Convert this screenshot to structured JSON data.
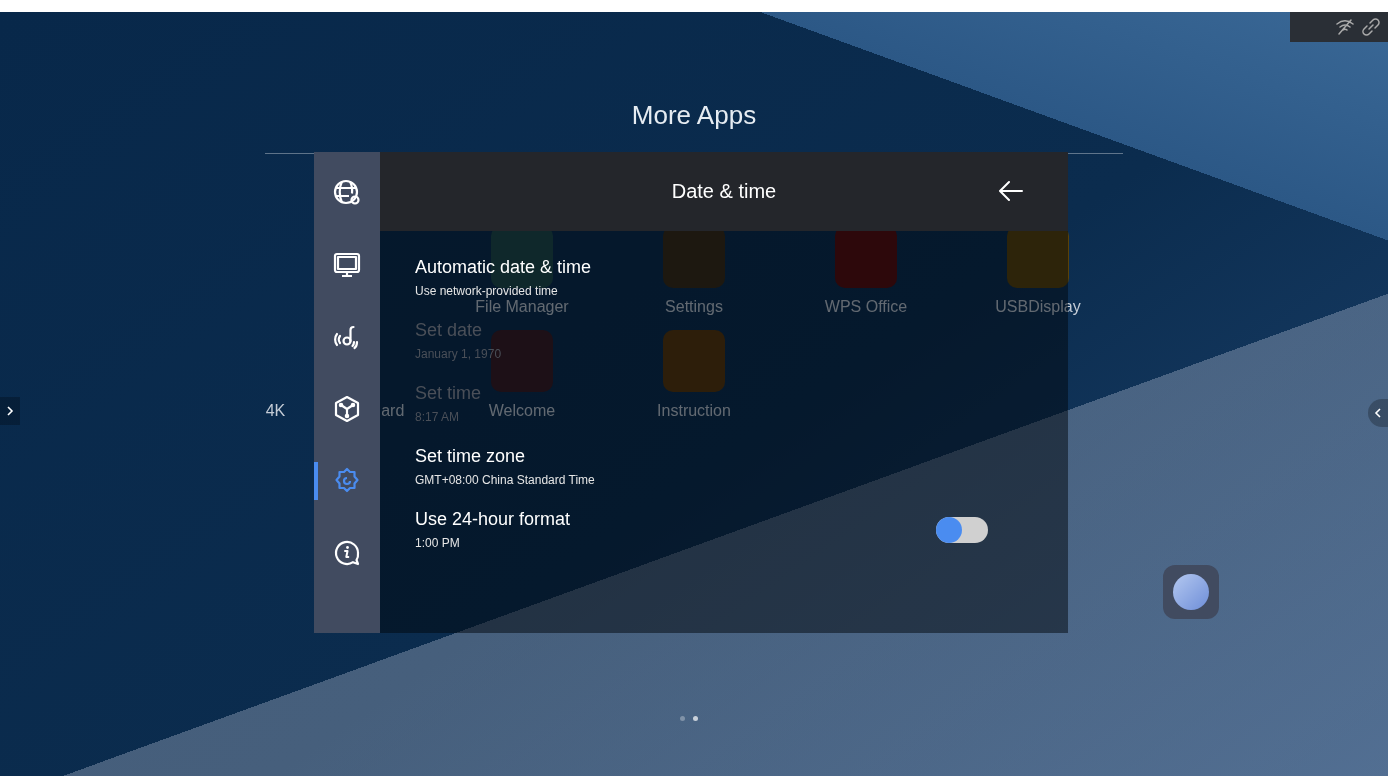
{
  "launcher": {
    "title": "More Apps",
    "rows": [
      [
        {},
        {
          "label": "File Manager",
          "kind": "folder"
        },
        {
          "label": "Settings",
          "kind": "gear"
        },
        {
          "label": "WPS Office",
          "kind": "wps"
        },
        {
          "label": "USBDisplay",
          "kind": "monitor"
        }
      ],
      [
        {
          "label": "4K",
          "tail": "ard"
        },
        {
          "label": "Welcome",
          "kind": "hand"
        },
        {
          "label": "Instruction",
          "kind": "book"
        }
      ]
    ],
    "page_dots": [
      {
        "selected": false
      },
      {
        "selected": true
      }
    ]
  },
  "sidebar": {
    "items": [
      {
        "kind": "network",
        "selected": false
      },
      {
        "kind": "display",
        "selected": false
      },
      {
        "kind": "audio",
        "selected": false
      },
      {
        "kind": "cube",
        "selected": false
      },
      {
        "kind": "settings",
        "selected": true
      },
      {
        "kind": "info",
        "selected": false
      }
    ]
  },
  "dialog": {
    "title": "Date & time",
    "items": [
      {
        "kind": "plain",
        "title": "Automatic date & time",
        "subtitle": "Use network-provided time",
        "disabled": false
      },
      {
        "kind": "plain",
        "title": "Set date",
        "subtitle": "January 1, 1970",
        "disabled": true
      },
      {
        "kind": "plain",
        "title": "Set time",
        "subtitle": "8:17 AM",
        "disabled": true
      },
      {
        "kind": "plain",
        "title": "Set time zone",
        "subtitle": "GMT+08:00 China Standard Time",
        "disabled": false
      },
      {
        "kind": "toggle",
        "title": "Use 24-hour format",
        "subtitle": "1:00 PM",
        "disabled": false,
        "on": false
      }
    ]
  }
}
